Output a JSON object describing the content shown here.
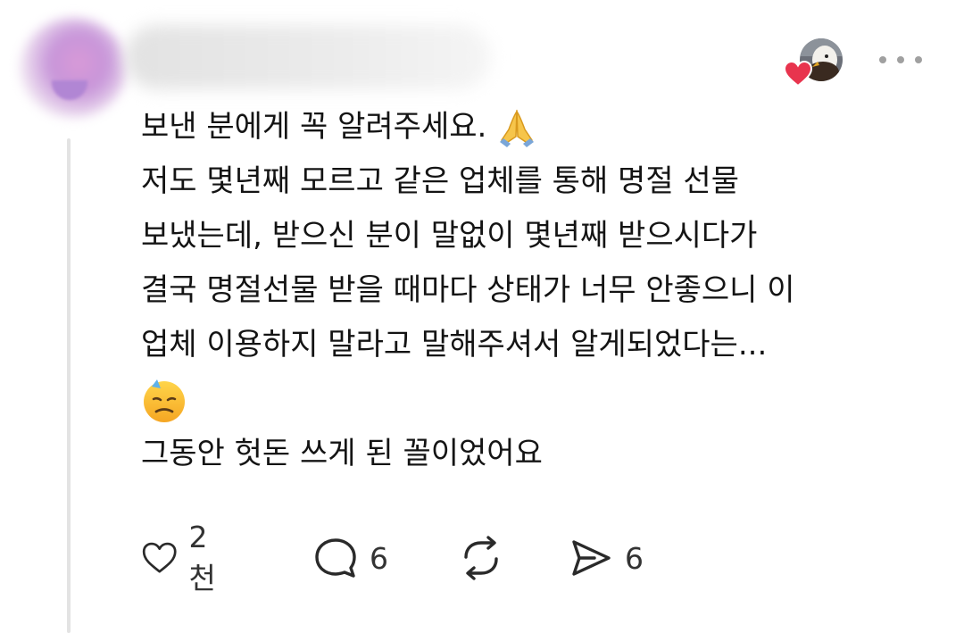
{
  "post": {
    "lines": [
      "보낸 분에게 꼭 알려주세요.",
      "저도 몇년째 모르고 같은 업체를 통해 명절 선물",
      "보냈는데, 받으신 분이 말없이 몇년째 받으시다가",
      "결국 명절선물 받을 때마다 상태가 너무 안좋으니 이",
      "업체 이용하지 말라고 말해주셔서 알게되었다는...",
      "그동안 헛돈 쓰게 된 꼴이었어요"
    ],
    "emojis": {
      "line1": "folded-hands-emoji",
      "line7": "downcast-face-with-sweat-emoji"
    }
  },
  "actions": {
    "like_count": "2천",
    "reply_count": "6",
    "share_count": "6"
  },
  "icons": [
    "heart-icon",
    "comment-icon",
    "repost-icon",
    "send-icon",
    "more-icon"
  ],
  "colors": {
    "heart_badge": "#e8344e",
    "icon_stroke": "#2a2a2a",
    "thread_line": "#e3e3e3"
  }
}
